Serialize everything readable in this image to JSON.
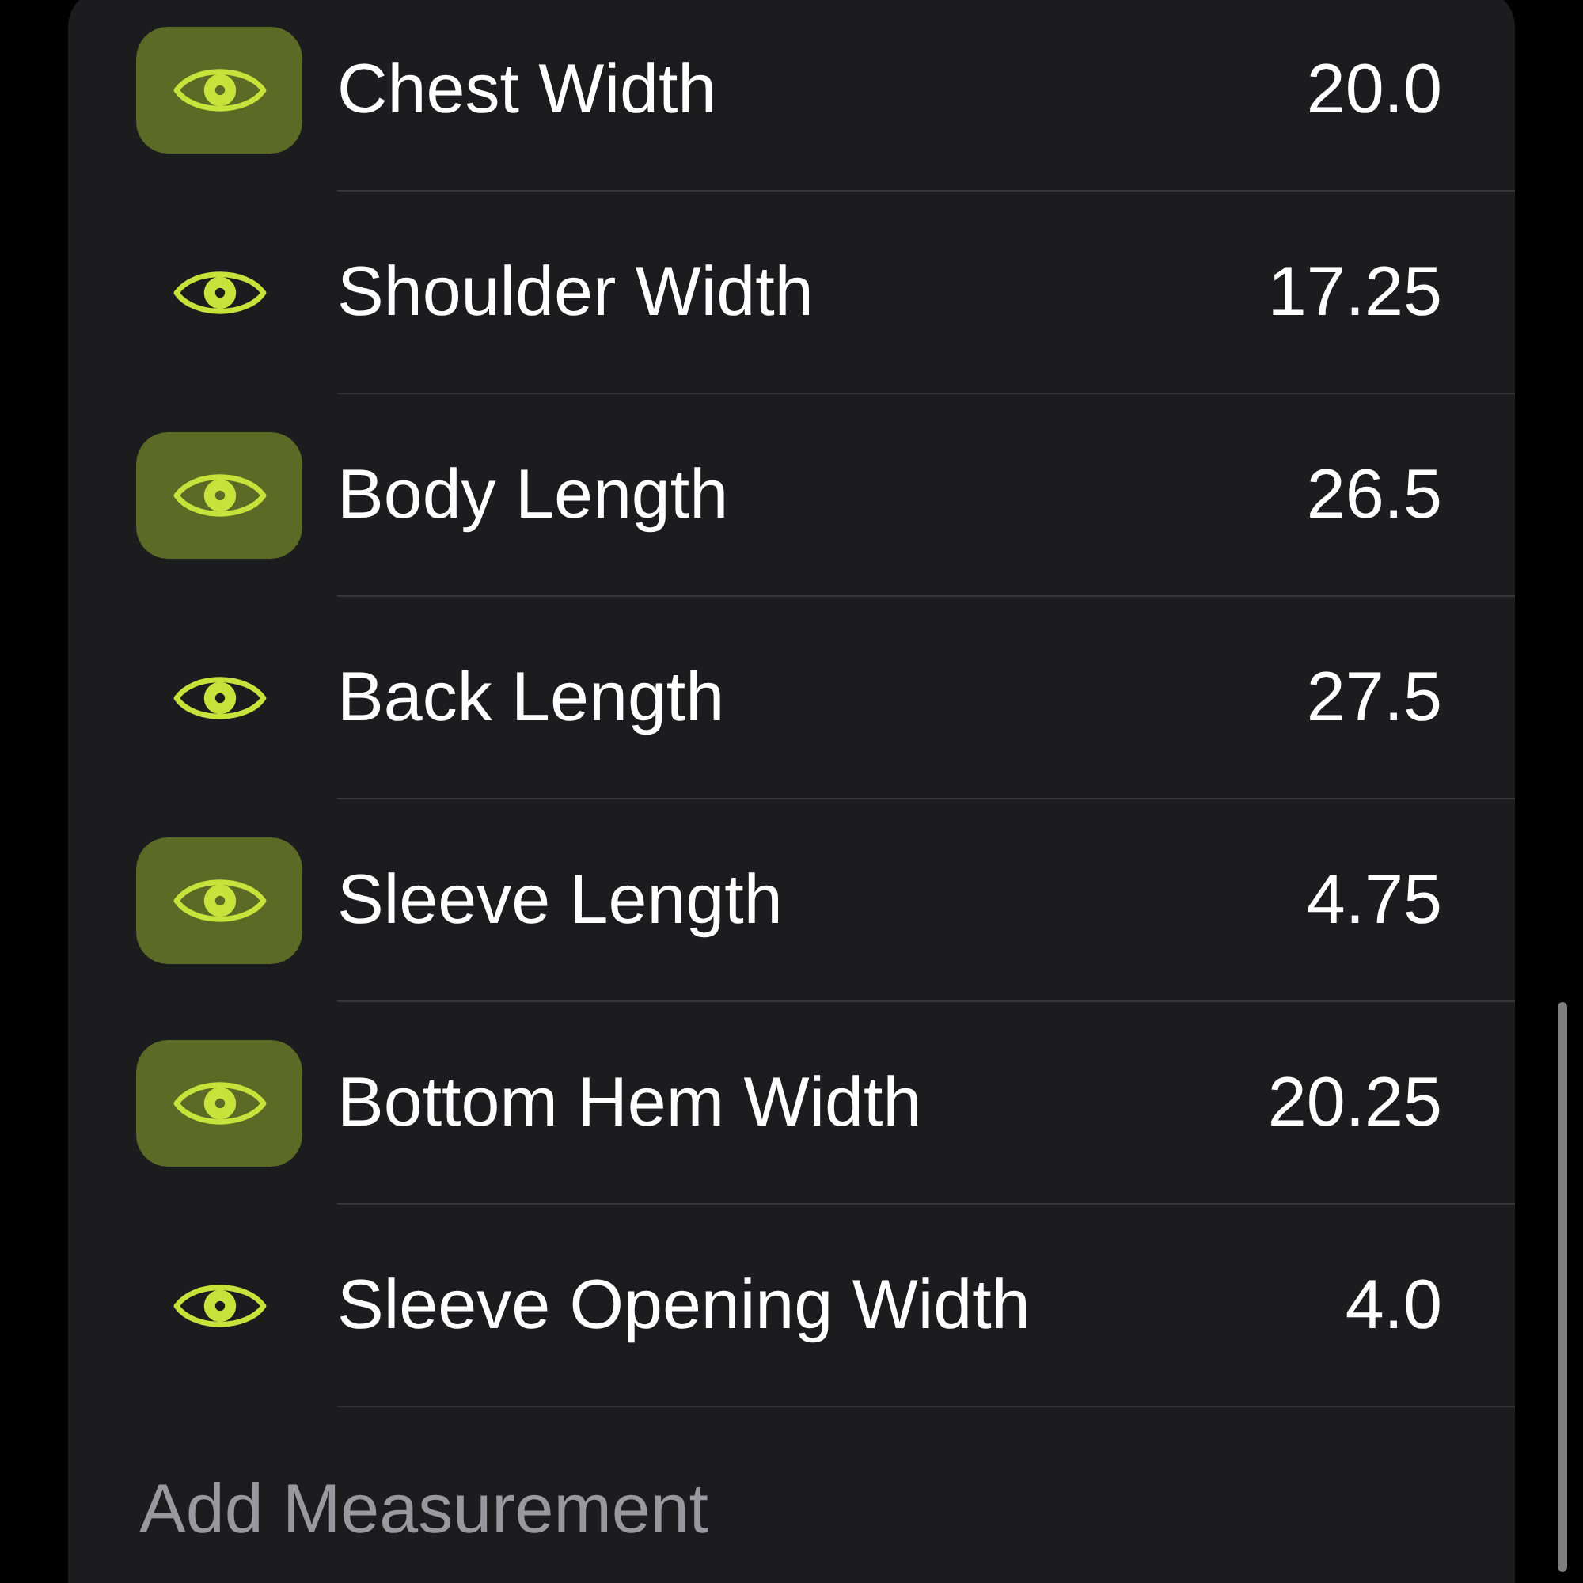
{
  "measurements": [
    {
      "name": "Chest Width",
      "value": "20.0",
      "selected": true
    },
    {
      "name": "Shoulder Width",
      "value": "17.25",
      "selected": false
    },
    {
      "name": "Body Length",
      "value": "26.5",
      "selected": true
    },
    {
      "name": "Back Length",
      "value": "27.5",
      "selected": false
    },
    {
      "name": "Sleeve Length",
      "value": "4.75",
      "selected": true
    },
    {
      "name": "Bottom Hem Width",
      "value": "20.25",
      "selected": true
    },
    {
      "name": "Sleeve Opening Width",
      "value": "4.0",
      "selected": false
    }
  ],
  "add_field": {
    "placeholder": "Add Measurement"
  }
}
